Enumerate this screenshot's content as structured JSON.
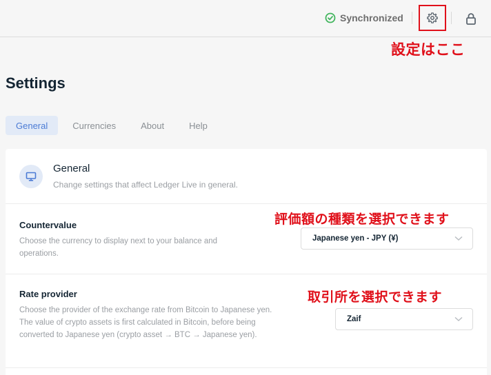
{
  "topbar": {
    "sync_label": "Synchronized",
    "sync_color": "#41b55d"
  },
  "annotations": {
    "settings_here": "設定はここ",
    "countervalue_note": "評価額の種類を選択できます",
    "rate_provider_note": "取引所を選択できます",
    "color": "#e0101a"
  },
  "page": {
    "title": "Settings"
  },
  "tabs": [
    {
      "label": "General",
      "active": true
    },
    {
      "label": "Currencies",
      "active": false
    },
    {
      "label": "About",
      "active": false
    },
    {
      "label": "Help",
      "active": false
    }
  ],
  "section": {
    "icon": "monitor-icon",
    "title": "General",
    "description": "Change settings that affect Ledger Live in general."
  },
  "countervalue": {
    "title": "Countervalue",
    "description": "Choose the currency to display next to your balance and operations.",
    "selected": "Japanese yen - JPY (¥)"
  },
  "rate_provider": {
    "title": "Rate provider",
    "description": "Choose the provider of the exchange rate from Bitcoin to Japanese yen. The value of crypto assets is first calculated in Bitcoin, before being converted to Japanese yen (crypto asset → BTC → Japanese yen).",
    "selected": "Zaif"
  },
  "colors": {
    "accent": "#4b7bd5",
    "accent_bg": "#e2eaf7"
  }
}
